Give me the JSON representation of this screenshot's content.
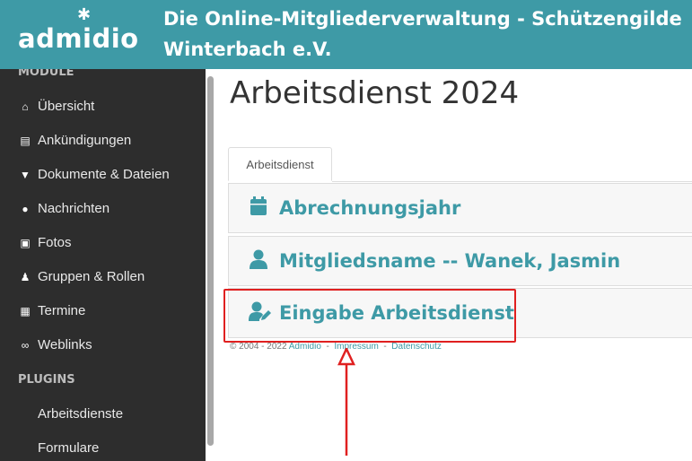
{
  "header": {
    "logo_text": "admidio",
    "title": "Die Online-Mitgliederverwaltung - Schützengilde\nWinterbach e.V."
  },
  "sidebar": {
    "section_module": "MODULE",
    "items": [
      {
        "label": "Übersicht",
        "icon": "home-icon",
        "glyph": "⌂"
      },
      {
        "label": "Ankündigungen",
        "icon": "newspaper-icon",
        "glyph": "▤"
      },
      {
        "label": "Dokumente & Dateien",
        "icon": "file-download-icon",
        "glyph": "▼"
      },
      {
        "label": "Nachrichten",
        "icon": "comments-icon",
        "glyph": "●"
      },
      {
        "label": "Fotos",
        "icon": "image-icon",
        "glyph": "▣"
      },
      {
        "label": "Gruppen & Rollen",
        "icon": "users-icon",
        "glyph": "♟"
      },
      {
        "label": "Termine",
        "icon": "calendar-icon",
        "glyph": "▦"
      },
      {
        "label": "Weblinks",
        "icon": "link-icon",
        "glyph": "∞"
      }
    ],
    "section_plugins": "PLUGINS",
    "plugins": [
      "Arbeitsdienste",
      "Formulare"
    ]
  },
  "main": {
    "page_title": "Arbeitsdienst 2024",
    "tab_label": "Arbeitsdienst",
    "panels": [
      {
        "label": "Abrechnungsjahr",
        "icon": "calendar-icon"
      },
      {
        "label": "Mitgliedsname -- Wanek, Jasmin",
        "icon": "user-icon"
      },
      {
        "label": "Eingabe Arbeitsdienst",
        "icon": "user-edit-icon"
      }
    ]
  },
  "footer": {
    "copyright": "© 2004 - 2022",
    "admidio": "Admidio",
    "sep1": "-",
    "impressum": "Impressum",
    "sep2": "-",
    "datenschutz": "Datenschutz"
  },
  "colors": {
    "accent": "#3e9aa6",
    "sidebar_bg": "#2d2d2d",
    "annotation": "#e02020"
  }
}
